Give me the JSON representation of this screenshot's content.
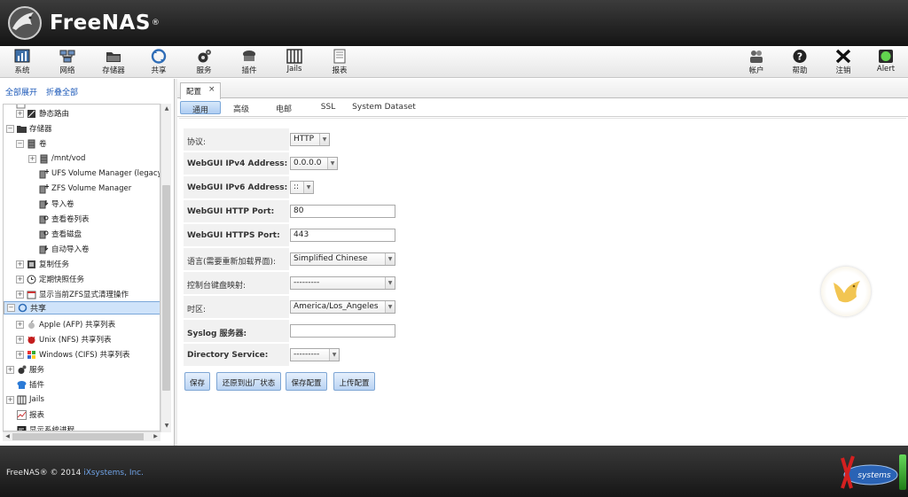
{
  "brand": {
    "name": "FreeNAS",
    "reg": "®"
  },
  "toolbar": {
    "left": [
      {
        "id": "system",
        "label": "系统",
        "icon": "system-icon"
      },
      {
        "id": "network",
        "label": "网络",
        "icon": "network-icon"
      },
      {
        "id": "storage",
        "label": "存储器",
        "icon": "storage-icon"
      },
      {
        "id": "sharing",
        "label": "共享",
        "icon": "sharing-icon"
      },
      {
        "id": "services",
        "label": "服务",
        "icon": "services-icon"
      },
      {
        "id": "plugins",
        "label": "插件",
        "icon": "plugins-icon"
      },
      {
        "id": "jails",
        "label": "Jails",
        "icon": "jails-icon"
      },
      {
        "id": "reports",
        "label": "报表",
        "icon": "reports-icon"
      }
    ],
    "right": [
      {
        "id": "account",
        "label": "帐户",
        "icon": "account-icon"
      },
      {
        "id": "help",
        "label": "帮助",
        "icon": "help-icon"
      },
      {
        "id": "logout",
        "label": "注销",
        "icon": "logout-icon"
      },
      {
        "id": "alert",
        "label": "Alert",
        "icon": "alert-icon"
      }
    ]
  },
  "sidebar": {
    "expand_all": "全部展开",
    "collapse_all": "折叠全部",
    "tree": [
      {
        "label": "静态路由",
        "toggle": "+"
      },
      {
        "label": "存储器",
        "toggle": "−"
      },
      {
        "label": "卷",
        "toggle": "−"
      },
      {
        "label": "/mnt/vod",
        "toggle": "+"
      },
      {
        "label": "UFS Volume Manager (legacy)",
        "toggle": ""
      },
      {
        "label": "ZFS Volume Manager",
        "toggle": ""
      },
      {
        "label": "导入卷",
        "toggle": ""
      },
      {
        "label": "查看卷列表",
        "toggle": ""
      },
      {
        "label": "查看磁盘",
        "toggle": ""
      },
      {
        "label": "自动导入卷",
        "toggle": ""
      },
      {
        "label": "复制任务",
        "toggle": "+"
      },
      {
        "label": "定期快照任务",
        "toggle": "+"
      },
      {
        "label": "显示当前ZFS显式清理操作",
        "toggle": "+"
      },
      {
        "label": "共享",
        "toggle": "−"
      },
      {
        "label": "Apple (AFP) 共享列表",
        "toggle": "+"
      },
      {
        "label": "Unix (NFS) 共享列表",
        "toggle": "+"
      },
      {
        "label": "Windows (CIFS) 共享列表",
        "toggle": "+"
      },
      {
        "label": "服务",
        "toggle": "+"
      },
      {
        "label": "插件",
        "toggle": ""
      },
      {
        "label": "Jails",
        "toggle": "+"
      },
      {
        "label": "报表",
        "toggle": ""
      },
      {
        "label": "显示系统进程",
        "toggle": ""
      }
    ]
  },
  "main": {
    "tab_label": "配置",
    "tab_close": "×",
    "subtabs": [
      "通用",
      "高级",
      "电邮",
      "SSL",
      "System Dataset"
    ],
    "active_subtab": "通用",
    "form": {
      "protocol": {
        "label": "协议:",
        "value": "HTTP"
      },
      "ipv4": {
        "label": "WebGUI IPv4 Address:",
        "value": "0.0.0.0"
      },
      "ipv6": {
        "label": "WebGUI IPv6 Address:",
        "value": "::"
      },
      "http_port": {
        "label": "WebGUI HTTP Port:",
        "value": "80"
      },
      "https_port": {
        "label": "WebGUI HTTPS Port:",
        "value": "443"
      },
      "language": {
        "label": "语言(需要重新加载界面):",
        "value": "Simplified Chinese"
      },
      "keymap": {
        "label": "控制台键盘映射:",
        "value": "---------"
      },
      "timezone": {
        "label": "时区:",
        "value": "America/Los_Angeles"
      },
      "syslog": {
        "label": "Syslog 服务器:",
        "value": ""
      },
      "directory": {
        "label": "Directory Service:",
        "value": "---------"
      }
    },
    "buttons": {
      "save": "保存",
      "factory_restore": "还原到出厂状态",
      "save_config": "保存配置",
      "upload_config": "上传配置"
    }
  },
  "footer": {
    "copyright": "FreeNAS® © 2014",
    "company": "iXsystems, Inc.",
    "logo_text": "systems"
  }
}
